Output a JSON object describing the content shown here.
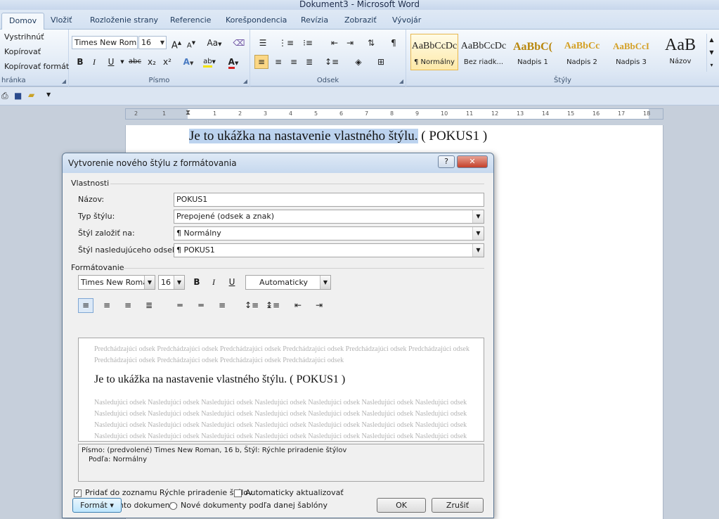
{
  "window": {
    "title": "Dokument3 - Microsoft Word"
  },
  "tabs": [
    {
      "label": "Domov",
      "active": true
    },
    {
      "label": "Vložiť"
    },
    {
      "label": "Rozloženie strany"
    },
    {
      "label": "Referencie"
    },
    {
      "label": "Korešpondencia"
    },
    {
      "label": "Revízia"
    },
    {
      "label": "Zobraziť"
    },
    {
      "label": "Vývojár"
    }
  ],
  "ribbon": {
    "clipboard": {
      "cut": "Vystrihnúť",
      "copy": "Kopírovať",
      "format_painter": "Kopírovať formát",
      "label": "hránka"
    },
    "font": {
      "name": "Times New Rom",
      "size": "16",
      "label": "Písmo",
      "grow": "A",
      "shrink": "A",
      "change_case": "Aa",
      "bold": "B",
      "italic": "I",
      "underline": "U",
      "strike": "abc",
      "sub": "x₂",
      "sup": "x²"
    },
    "paragraph": {
      "label": "Odsek"
    },
    "styles": {
      "label": "Štýly",
      "items": [
        {
          "sample": "AaBbCcDc",
          "name": "¶ Normálny",
          "selected": true
        },
        {
          "sample": "AaBbCcDc",
          "name": "Bez riadk..."
        },
        {
          "sample": "AaBbC(",
          "name": "Nadpis 1"
        },
        {
          "sample": "AaBbCc",
          "name": "Nadpis 2"
        },
        {
          "sample": "AaBbCcI",
          "name": "Nadpis 3"
        },
        {
          "sample": "AaB",
          "name": "Názov"
        }
      ]
    }
  },
  "ruler": {
    "ticks": [
      "2",
      "1",
      "1",
      "2",
      "3",
      "4",
      "5",
      "6",
      "7",
      "8",
      "9",
      "10",
      "11",
      "12",
      "13",
      "14",
      "15",
      "16",
      "17",
      "18"
    ]
  },
  "document": {
    "text": "Je to ukážka na nastavenie vlastného štýlu.",
    "suffix": " ( POKUS1 )"
  },
  "dialog": {
    "title": "Vytvorenie nového štýlu z formátovania",
    "help": "?",
    "close": "✕",
    "properties": {
      "section": "Vlastnosti",
      "name_label": "Názov:",
      "name_value": "POKUS1",
      "type_label": "Typ štýlu:",
      "type_value": "Prepojené (odsek a znak)",
      "based_label": "Štýl založiť na:",
      "based_value": "¶  Normálny",
      "next_label": "Štýl nasledujúceho odseku:",
      "next_value": "¶  POKUS1"
    },
    "formatting": {
      "section": "Formátovanie",
      "font": "Times New Roman",
      "size": "16",
      "bold": "B",
      "italic": "I",
      "underline": "U",
      "color": "Automaticky"
    },
    "preview": {
      "previous": "Predchádzajúci odsek Predchádzajúci odsek Predchádzajúci odsek Predchádzajúci odsek Predchádzajúci odsek Predchádzajúci odsek Predchádzajúci odsek Predchádzajúci odsek Predchádzajúci odsek Predchádzajúci odsek",
      "sample": "Je to ukážka na nastavenie vlastného štýlu. ( POKUS1 )",
      "next": "Nasledujúci odsek Nasledujúci odsek Nasledujúci odsek Nasledujúci odsek Nasledujúci odsek Nasledujúci odsek Nasledujúci odsek Nasledujúci odsek Nasledujúci odsek Nasledujúci odsek Nasledujúci odsek Nasledujúci odsek Nasledujúci odsek Nasledujúci odsek Nasledujúci odsek Nasledujúci odsek Nasledujúci odsek Nasledujúci odsek Nasledujúci odsek Nasledujúci odsek Nasledujúci odsek Nasledujúci odsek Nasledujúci odsek Nasledujúci odsek Nasledujúci odsek Nasledujúci odsek Nasledujúci odsek Nasledujúci odsek"
    },
    "description": {
      "line1": "Písmo: (predvolené) Times New Roman, 16 b, Štýl: Rýchle priradenie štýlov",
      "line2": "Podľa: Normálny"
    },
    "options": {
      "add_quick": "Pridať do zoznamu Rýchle priradenie štýlov",
      "add_quick_checked": true,
      "auto_update": "Automaticky aktualizovať",
      "auto_update_checked": false,
      "only_doc": "Len v tomto dokumente",
      "new_docs": "Nové dokumenty podľa danej šablóny"
    },
    "buttons": {
      "format": "Formát ▾",
      "ok": "OK",
      "cancel": "Zrušiť"
    }
  }
}
